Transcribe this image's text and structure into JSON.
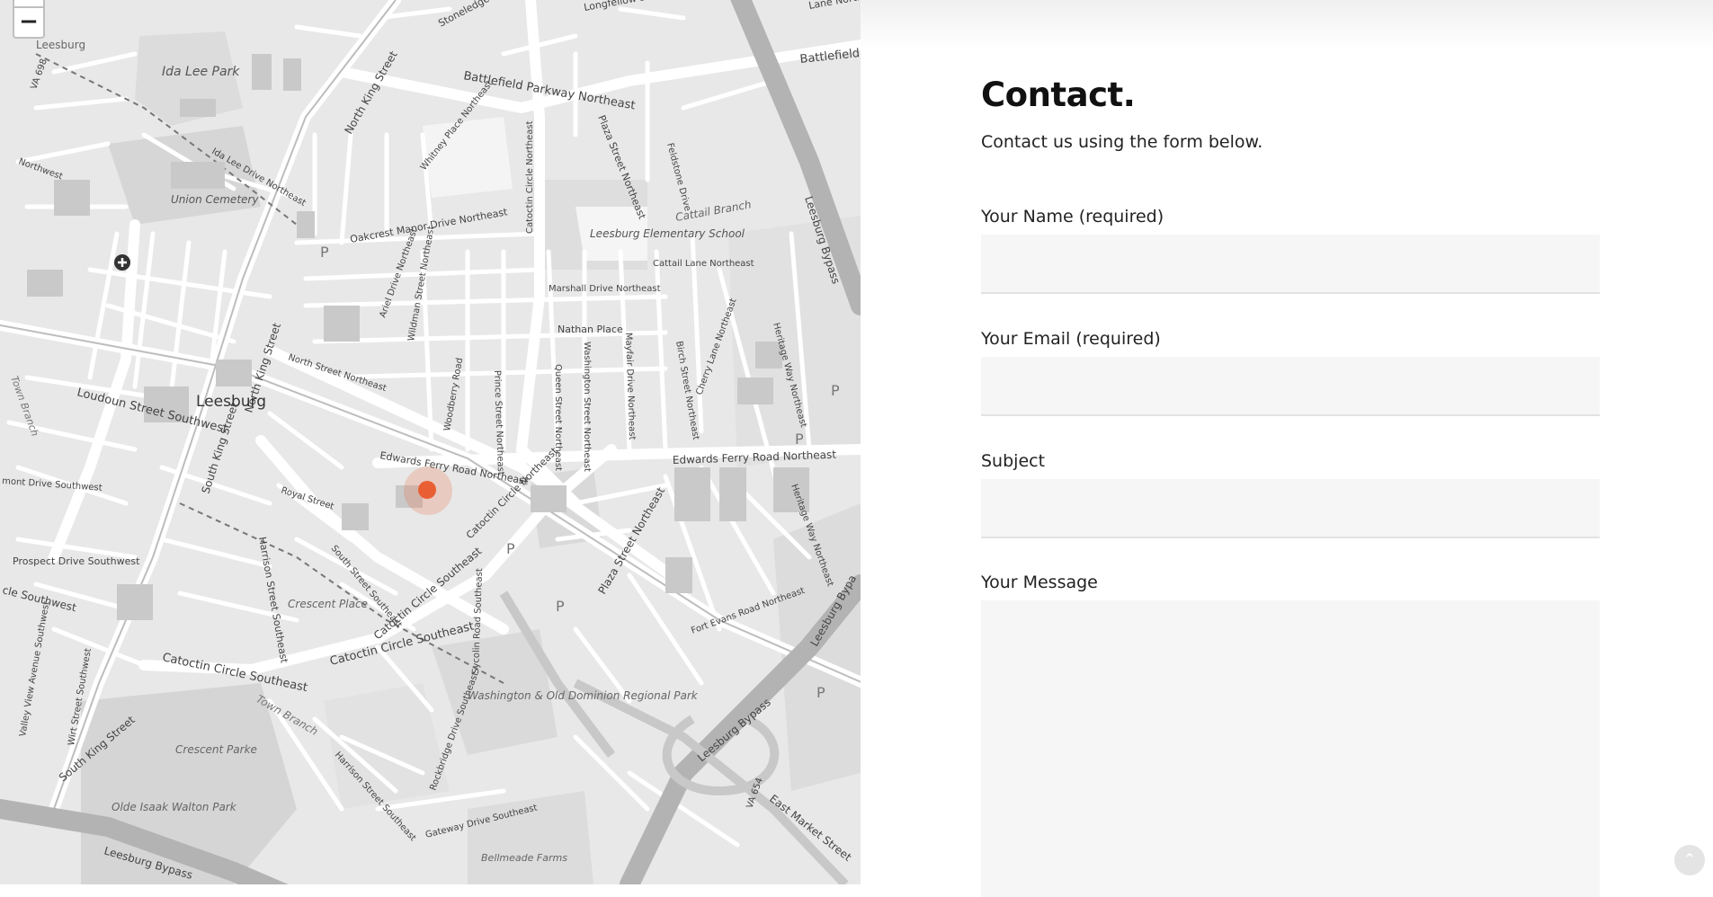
{
  "map": {
    "zoom_out_label": "−",
    "location_pin_icon": "map-marker",
    "labels": {
      "stoneledge": "Stoneledge Place Northeast",
      "longfellow": "Longfellow Drive N",
      "lane_n": "Lane North",
      "battlefield_parkway": "Battlefield Parkway Northeast",
      "battlefield_parkway_e": "Battlefield Park",
      "leesburg_corner": "Leesburg",
      "ida_lee_park": "Ida Lee Park",
      "va698": "VA 698",
      "north_king_upper": "North King Street",
      "whitney": "Whitney Place Northeast",
      "ida_lee_drive": "Ida Lee Drive Northeast",
      "union_cemetery": "Union Cemetery",
      "northwest": "Northwest",
      "oakcrest": "Oakcrest Manor Drive Northeast",
      "catoctin_circle_ne_upper": "Catoctin Circle Northeast",
      "plaza_street_ne_upper": "Plaza Street Northeast",
      "feldstone": "Feldstone Drive",
      "cattail_branch": "Cattail Branch",
      "leesburg_elementary": "Leesburg Elementary School",
      "cattail_lane": "Cattail Lane Northeast",
      "leesburg_bypass_upper": "Leesburg Bypass",
      "marshall_drive": "Marshall Drive Northeast",
      "ariel_drive": "Ariel Drive Northeast",
      "wildman": "Wildman Street Northeast",
      "north_king_lower": "North King Street",
      "north_street": "North Street Northeast",
      "nathan_place": "Nathan Place",
      "washington_street": "Washington Street Northeast",
      "queen_street": "Queen Street Northeast",
      "mayfair": "Mayfair Drive Northeast",
      "birch": "Birch Street Northeast",
      "cherry_lane": "Cherry Lane Northeast",
      "heritage_upper": "Heritage Way Northeast",
      "woodberry": "Woodberry Road",
      "prince_street": "Prince Street Northeast",
      "leesburg_town": "Leesburg",
      "loudoun_street": "Loudoun Street Southwest",
      "south_king_upper": "South King Street",
      "town_branch_upper": "Town Branch",
      "edwards_ferry_w": "Edwards Ferry Road Northeast",
      "edwards_ferry_e": "Edwards Ferry Road Northeast",
      "catoctin_circle_ne_lower": "Catoctin Circle Northeast",
      "royal_street": "Royal Street",
      "heritage_lower": "Heritage Way Northeast",
      "plaza_street_ne_lower": "Plaza Street Northeast",
      "mont_drive": "mont Drive Southwest",
      "prospect_drive": "Prospect Drive Southwest",
      "harrison_upper": "Harrison Street Southeast",
      "south_street": "South Street Southeast",
      "crescent_place": "Crescent Place",
      "catoctin_circle_se": "Catoctin Circle Southeast",
      "sycolin": "Sycolin Road Southeast",
      "fort_evans": "Fort Evans Road Northeast",
      "leesburg_bypass_right": "Leesburg Bypa",
      "cle_southwest": "cle Southwest",
      "valley_view": "Valley View Avenue Southwest",
      "wirt_street": "Wirt Street Southwest",
      "catoctin_circle_se_lower": "Catoctin Circle Southeast",
      "catoctin_circle_se_mid": "Catoctin Circle Southeast",
      "wod_trail": "Washington & Old Dominion Regional Park",
      "town_branch_lower": "Town Branch",
      "leesburg_bypass_ramp": "Leesburg Bypass",
      "east_market": "East Market Street",
      "south_king_lower": "South King Street",
      "crescent_parke": "Crescent Parke",
      "olde_izaak": "Olde Isaak Walton Park",
      "harrison_lower": "Harrison Street Southeast",
      "rockbridge": "Rockbridge Drive Southeast",
      "gateway_drive": "Gateway Drive Southeast",
      "bellmeade": "Bellmeade Farms",
      "leesburg_bypass_bottom": "Leesburg Bypass",
      "va654": "VA 654",
      "parking": "P"
    }
  },
  "contact": {
    "title": "Contact.",
    "intro": "Contact us using the form below.",
    "name_label": "Your Name (required)",
    "email_label": "Your Email (required)",
    "subject_label": "Subject",
    "message_label": "Your Message",
    "name_value": "",
    "email_value": "",
    "subject_value": "",
    "message_value": ""
  },
  "back_to_top_icon": "chevron-up"
}
